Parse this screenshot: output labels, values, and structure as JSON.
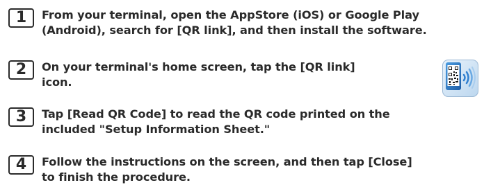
{
  "steps": [
    {
      "number": "1",
      "line1": "From your terminal, open the AppStore (iOS) or Google Play",
      "line2": "(Android), search for [QR link], and then install the software."
    },
    {
      "number": "2",
      "line1": "On your terminal's home screen, tap the [QR link]",
      "line2": "icon."
    },
    {
      "number": "3",
      "line1": "Tap [Read QR Code] to read the QR code printed on the",
      "line2": "included \"Setup Information Sheet.\""
    },
    {
      "number": "4",
      "line1": "Follow the instructions on the screen, and then tap [Close]",
      "line2": "to finish the procedure."
    }
  ],
  "icon": {
    "name": "qr-link-app-icon",
    "accent": "#2f7fd0"
  }
}
